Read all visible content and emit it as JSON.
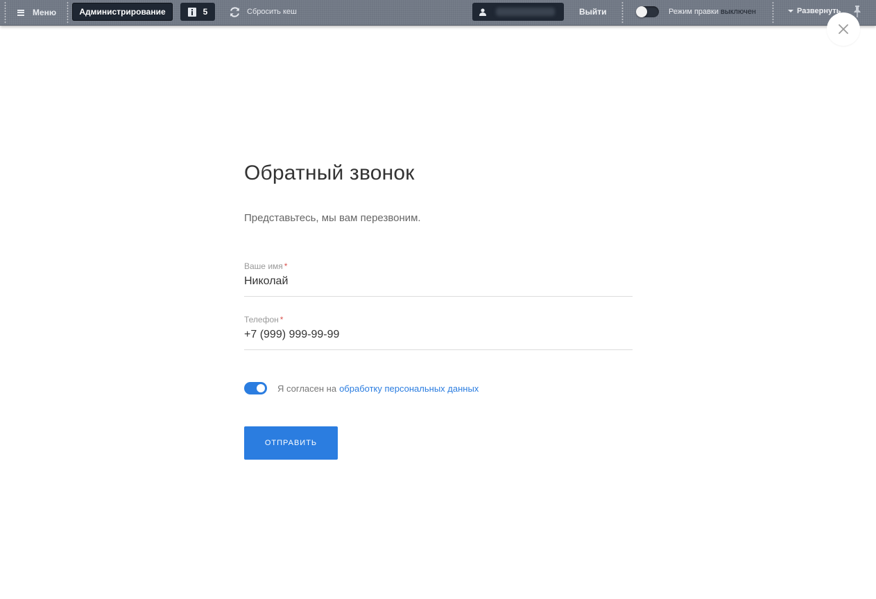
{
  "admin_panel": {
    "menu_label": "Меню",
    "admin_label": "Администрирование",
    "notifications_count": "5",
    "cache_label": "Сбросить кеш",
    "logout_label": "Выйти",
    "edit_mode_label": "Режим правки",
    "edit_mode_state": "выключен",
    "expand_label": "Развернуть"
  },
  "form": {
    "title": "Обратный звонок",
    "subtitle": "Представьтесь, мы вам перезвоним.",
    "name_field": {
      "label": "Ваше имя",
      "required_mark": "*",
      "value": "Николай"
    },
    "phone_field": {
      "label": "Телефон",
      "required_mark": "*",
      "value": "+7 (999) 999-99-99"
    },
    "consent_text": "Я согласен на",
    "consent_link": "обработку персональных данных",
    "submit_label": "ОТПРАВИТЬ"
  },
  "colors": {
    "accent": "#2b7de0",
    "panel_bg": "#6f7683",
    "panel_button_bg": "#1f2733"
  },
  "icons": [
    "menu-icon",
    "info-icon",
    "refresh-icon",
    "user-icon",
    "toggle-icon",
    "caret-down-icon",
    "pin-icon",
    "close-icon"
  ]
}
